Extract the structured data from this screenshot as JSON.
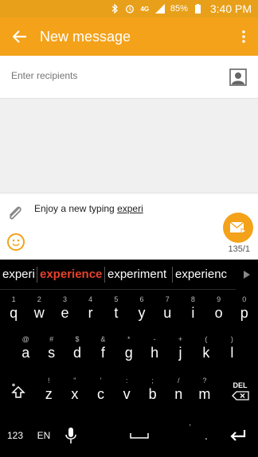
{
  "status_bar": {
    "battery": "85%",
    "time": "3:40 PM",
    "icons": [
      "bluetooth-icon",
      "alarm-icon",
      "4g-icon",
      "signal-icon",
      "battery-icon"
    ]
  },
  "app_bar": {
    "title": "New message"
  },
  "recipients": {
    "placeholder": "Enter recipients"
  },
  "composer": {
    "message_prefix": "Enjoy a new typing ",
    "message_current_word": "experi",
    "counter": "135/1"
  },
  "suggestions": {
    "typed": "experi",
    "items": [
      "experience",
      "experiment",
      "experienc"
    ]
  },
  "keyboard": {
    "row1": [
      {
        "main": "q",
        "sec": "1"
      },
      {
        "main": "w",
        "sec": "2"
      },
      {
        "main": "e",
        "sec": "3"
      },
      {
        "main": "r",
        "sec": "4"
      },
      {
        "main": "t",
        "sec": "5"
      },
      {
        "main": "y",
        "sec": "6"
      },
      {
        "main": "u",
        "sec": "7"
      },
      {
        "main": "i",
        "sec": "8"
      },
      {
        "main": "o",
        "sec": "9"
      },
      {
        "main": "p",
        "sec": "0"
      }
    ],
    "row2": [
      {
        "main": "a",
        "sec": "@"
      },
      {
        "main": "s",
        "sec": "#"
      },
      {
        "main": "d",
        "sec": "$"
      },
      {
        "main": "f",
        "sec": "&"
      },
      {
        "main": "g",
        "sec": "*"
      },
      {
        "main": "h",
        "sec": "-"
      },
      {
        "main": "j",
        "sec": "+"
      },
      {
        "main": "k",
        "sec": "("
      },
      {
        "main": "l",
        "sec": ")"
      }
    ],
    "row3": [
      {
        "main": "z",
        "sec": "!"
      },
      {
        "main": "x",
        "sec": "\""
      },
      {
        "main": "c",
        "sec": "'"
      },
      {
        "main": "v",
        "sec": ":"
      },
      {
        "main": "b",
        "sec": ";"
      },
      {
        "main": "n",
        "sec": "/"
      },
      {
        "main": "m",
        "sec": "?"
      }
    ],
    "del_label": "DEL",
    "sym_label": "123",
    "lang_label": "EN",
    "space_secondary": ",",
    "period_secondary": "."
  },
  "colors": {
    "accent": "#f4a21a",
    "suggestion_highlight": "#e8412b"
  }
}
